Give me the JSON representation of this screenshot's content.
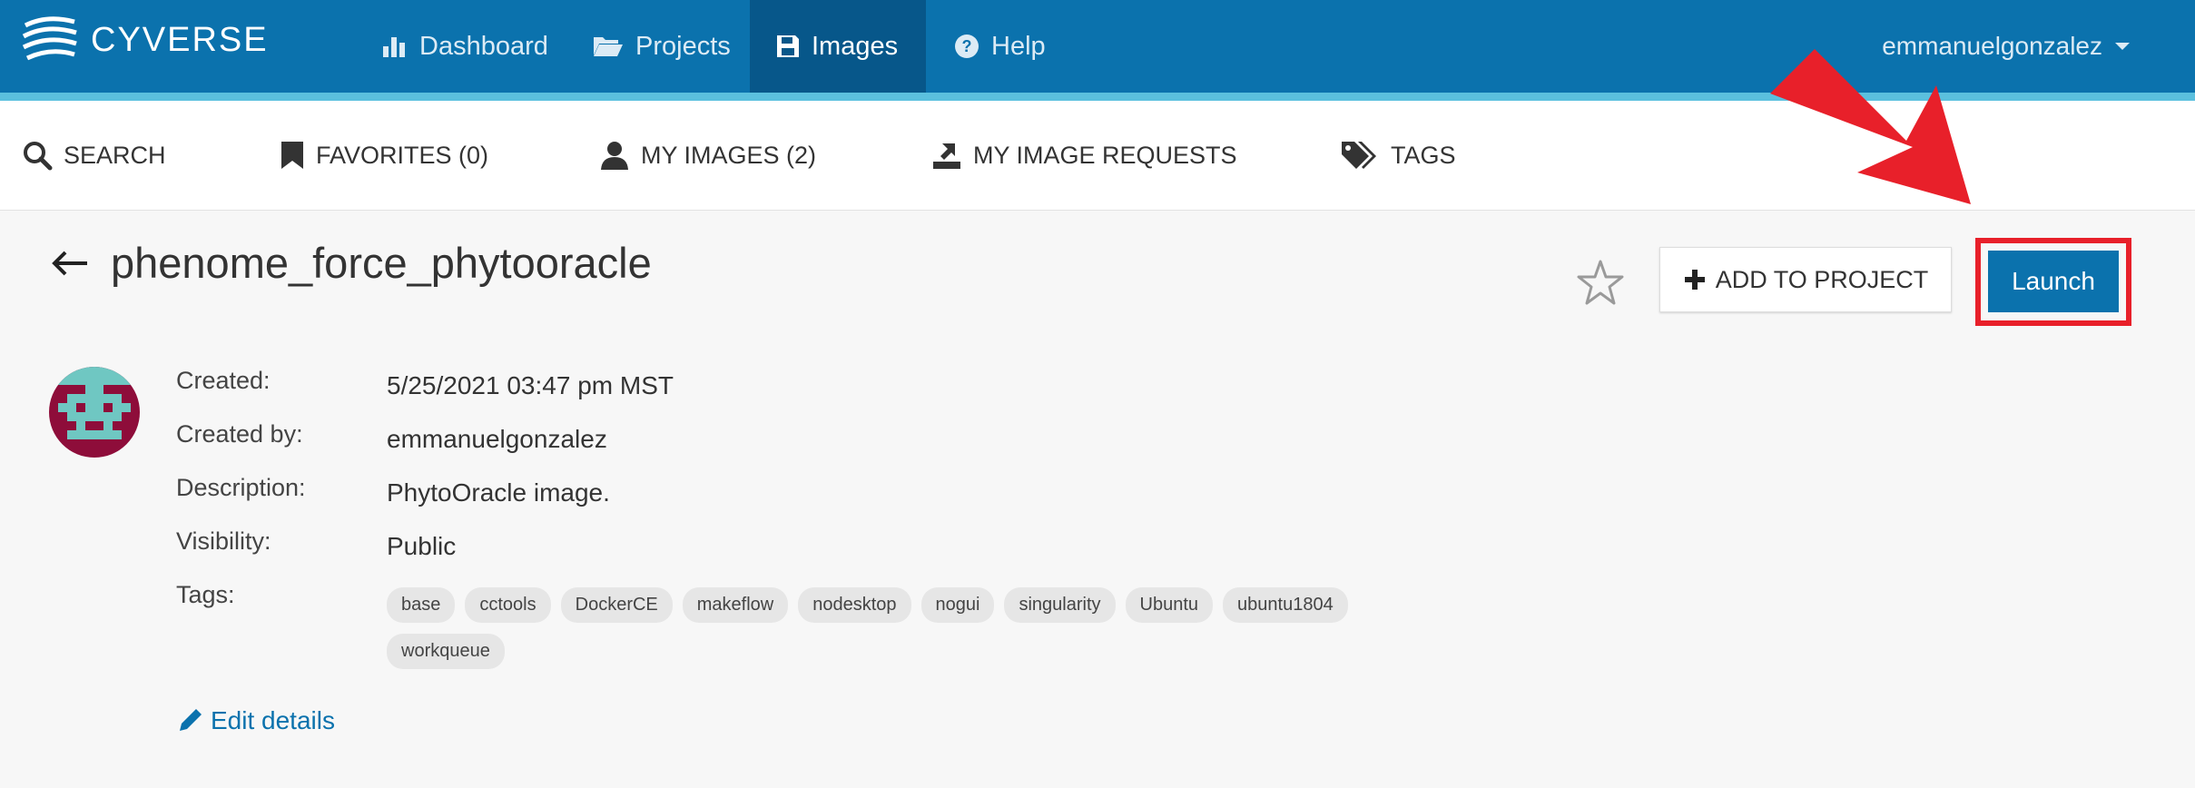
{
  "brand": {
    "name": "CYVERSE"
  },
  "nav": {
    "items": [
      {
        "label": "Dashboard",
        "icon": "bar-chart-icon"
      },
      {
        "label": "Projects",
        "icon": "folder-open-icon"
      },
      {
        "label": "Images",
        "icon": "floppy-disk-icon",
        "active": true
      },
      {
        "label": "Help",
        "icon": "question-circle-icon"
      }
    ],
    "user": "emmanuelgonzalez"
  },
  "subnav": {
    "items": [
      {
        "label": "SEARCH",
        "icon": "search-icon"
      },
      {
        "label": "FAVORITES (0)",
        "icon": "bookmark-icon"
      },
      {
        "label": "MY IMAGES (2)",
        "icon": "user-icon"
      },
      {
        "label": "MY IMAGE REQUESTS",
        "icon": "image-request-icon"
      },
      {
        "label": "TAGS",
        "icon": "tags-icon"
      }
    ]
  },
  "image": {
    "title": "phenome_force_phytooracle",
    "fields": [
      {
        "label": "Created:",
        "value": "5/25/2021 03:47 pm MST"
      },
      {
        "label": "Created by:",
        "value": "emmanuelgonzalez"
      },
      {
        "label": "Description:",
        "value": "PhytoOracle image."
      },
      {
        "label": "Visibility:",
        "value": "Public"
      },
      {
        "label": "Tags:",
        "value": ""
      }
    ],
    "tags": [
      "base",
      "cctools",
      "DockerCE",
      "makeflow",
      "nodesktop",
      "nogui",
      "singularity",
      "Ubuntu",
      "ubuntu1804",
      "workqueue"
    ]
  },
  "actions": {
    "add_to_project": "ADD TO PROJECT",
    "launch": "Launch",
    "edit_details": "Edit details"
  },
  "colors": {
    "brand_blue": "#0b72ad",
    "accent_light_blue": "#5bc0de",
    "annotation_red": "#e8202a",
    "avatar_bg": "#8e0d3a",
    "avatar_fg": "#6fc7c2"
  }
}
